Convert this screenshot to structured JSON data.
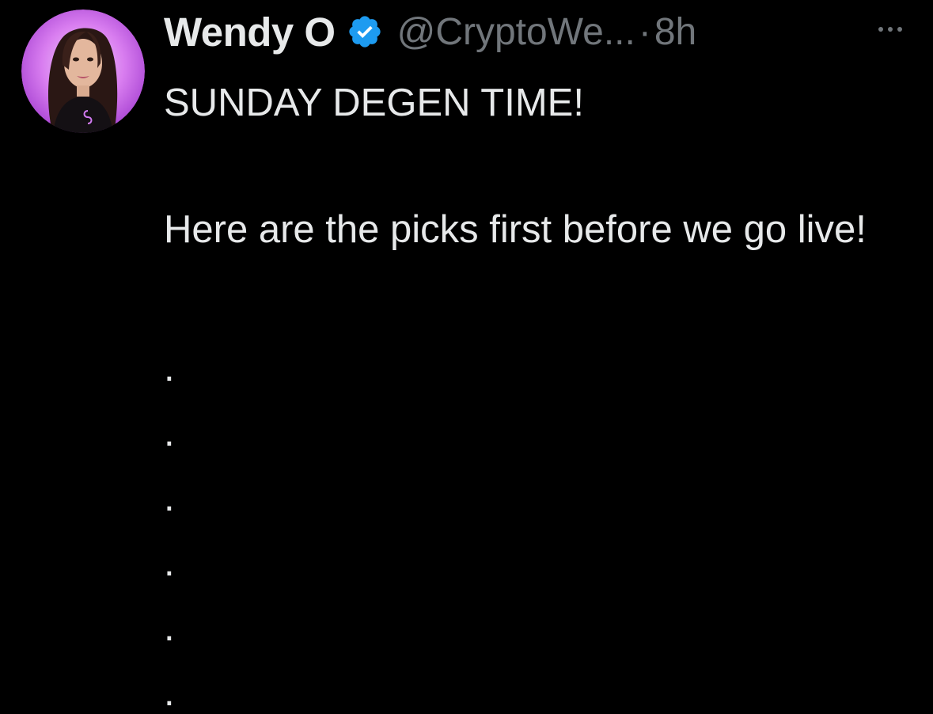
{
  "tweet": {
    "author": {
      "display_name": "Wendy O",
      "handle": "@CryptoWe...",
      "verified_icon": "verified-badge-icon",
      "avatar": "profile-avatar"
    },
    "separator": "·",
    "timestamp": "8h",
    "more_icon": "more-options-icon",
    "text_line_1": "SUNDAY DEGEN TIME!",
    "text_line_2": "Here are the picks first before we go live!",
    "dots": [
      ".",
      ".",
      ".",
      ".",
      ".",
      "."
    ]
  },
  "colors": {
    "background": "#000000",
    "primary_text": "#e7e9ea",
    "secondary_text": "#71767b",
    "verified_blue": "#1d9bf0",
    "avatar_ring": "#c24de0"
  }
}
